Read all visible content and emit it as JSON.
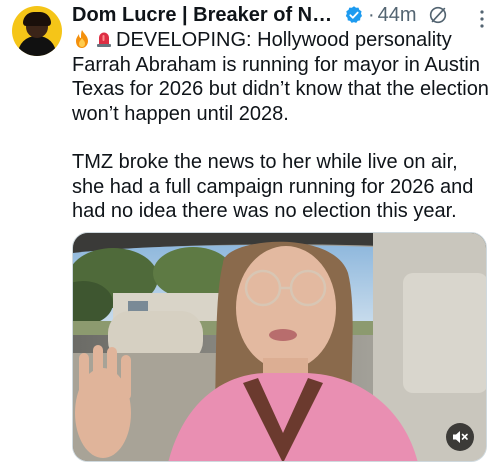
{
  "tweet": {
    "author": {
      "display_name": "Dom Lucre | Breaker of Narra...",
      "verified": true,
      "verified_color": "#1d9bf0"
    },
    "separator": "·",
    "time": "44m",
    "icons": {
      "grok": "grok-icon",
      "more": "more-vertical-icon",
      "emoji_1": "fire-emoji",
      "emoji_2": "siren-emoji",
      "mute": "volume-muted-icon"
    },
    "paragraph_1": "DEVELOPING: Hollywood personality Farrah Abraham is running for mayor in Austin Texas for 2026 but didn’t know that the election won’t happen until 2028.",
    "paragraph_2": "TMZ broke the news to her while live on air, she had a full campaign running for 2026 and had no idea there was no election this year.",
    "media": {
      "type": "video",
      "muted": true
    }
  }
}
